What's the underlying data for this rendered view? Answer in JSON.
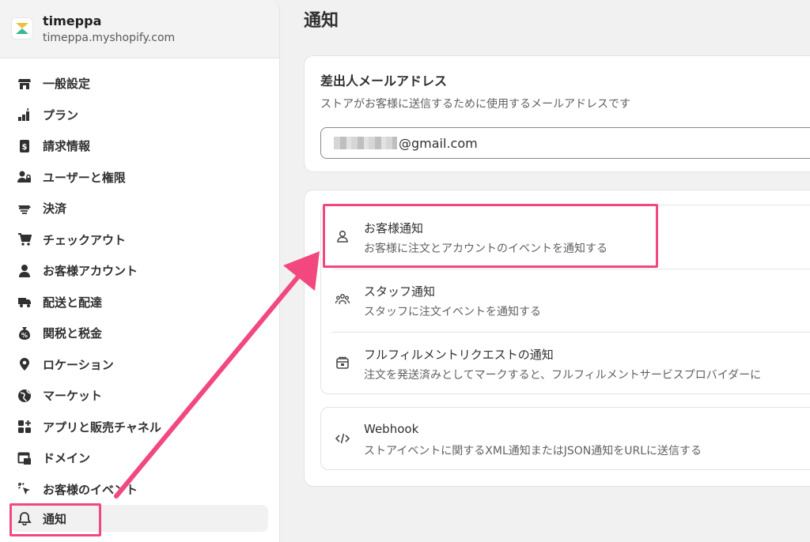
{
  "store": {
    "name": "timeppa",
    "domain": "timeppa.myshopify.com"
  },
  "sidebar": {
    "items": [
      {
        "label": "一般設定",
        "icon": "store-icon"
      },
      {
        "label": "プラン",
        "icon": "plan-icon"
      },
      {
        "label": "請求情報",
        "icon": "billing-icon"
      },
      {
        "label": "ユーザーと権限",
        "icon": "users-icon"
      },
      {
        "label": "決済",
        "icon": "payments-icon"
      },
      {
        "label": "チェックアウト",
        "icon": "cart-icon"
      },
      {
        "label": "お客様アカウント",
        "icon": "person-icon"
      },
      {
        "label": "配送と配達",
        "icon": "truck-icon"
      },
      {
        "label": "関税と税金",
        "icon": "tax-icon"
      },
      {
        "label": "ロケーション",
        "icon": "location-icon"
      },
      {
        "label": "マーケット",
        "icon": "globe-icon"
      },
      {
        "label": "アプリと販売チャネル",
        "icon": "apps-icon"
      },
      {
        "label": "ドメイン",
        "icon": "domain-icon"
      },
      {
        "label": "お客様のイベント",
        "icon": "cursor-icon"
      },
      {
        "label": "通知",
        "icon": "bell-icon"
      }
    ]
  },
  "main": {
    "title": "通知",
    "sender": {
      "title": "差出人メールアドレス",
      "subtitle": "ストアがお客様に送信するために使用するメールアドレスです",
      "email_suffix": "@gmail.com"
    },
    "notifications": [
      {
        "title": "お客様通知",
        "desc": "お客様に注文とアカウントのイベントを通知する",
        "icon": "customer-icon"
      },
      {
        "title": "スタッフ通知",
        "desc": "スタッフに注文イベントを通知する",
        "icon": "staff-icon"
      },
      {
        "title": "フルフィルメントリクエストの通知",
        "desc": "注文を発送済みとしてマークすると、フルフィルメントサービスプロバイダーに",
        "icon": "fulfillment-icon"
      }
    ],
    "webhook": {
      "title": "Webhook",
      "desc": "ストアイベントに関するXML通知またはJSON通知をURLに送信する",
      "icon": "code-icon"
    }
  },
  "colors": {
    "highlight": "#f2477f"
  }
}
